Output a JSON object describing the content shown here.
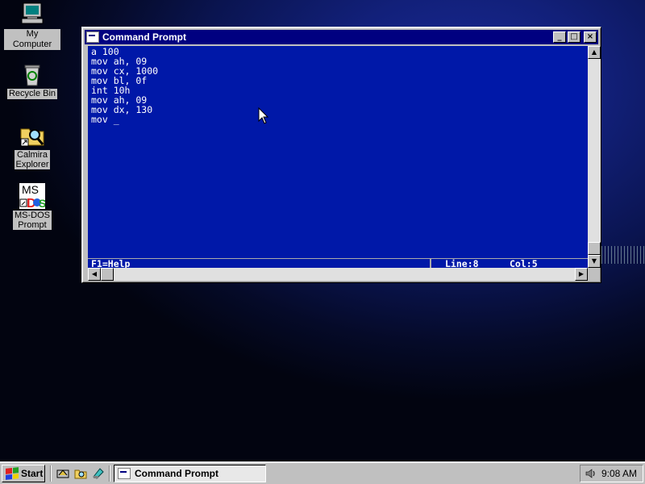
{
  "desktop": {
    "icons": [
      {
        "label": "My Computer",
        "icon": "computer-icon"
      },
      {
        "label": "Recycle Bin",
        "icon": "recycle-bin-icon"
      },
      {
        "label_line1": "Calmira",
        "label_line2": "Explorer",
        "icon": "explorer-icon"
      },
      {
        "label_line1": "MS-DOS",
        "label_line2": "Prompt",
        "icon": "msdos-icon",
        "badge": "MS"
      }
    ]
  },
  "window": {
    "title": "Command Prompt",
    "console_lines": [
      "a 100",
      "mov ah, 09",
      "mov cx, 1000",
      "mov bl, 0f",
      "int 10h",
      "mov ah, 09",
      "mov dx, 130",
      "mov _"
    ],
    "status": {
      "help": "F1=Help",
      "line": "Line:8",
      "col": "Col:5"
    },
    "buttons": {
      "minimize": "_",
      "maximize": "□",
      "close": "×"
    }
  },
  "taskbar": {
    "start_label": "Start",
    "task_button": "Command Prompt",
    "clock": "9:08 AM"
  },
  "colors": {
    "console_bg": "#0018a8",
    "titlebar": "#000080"
  }
}
